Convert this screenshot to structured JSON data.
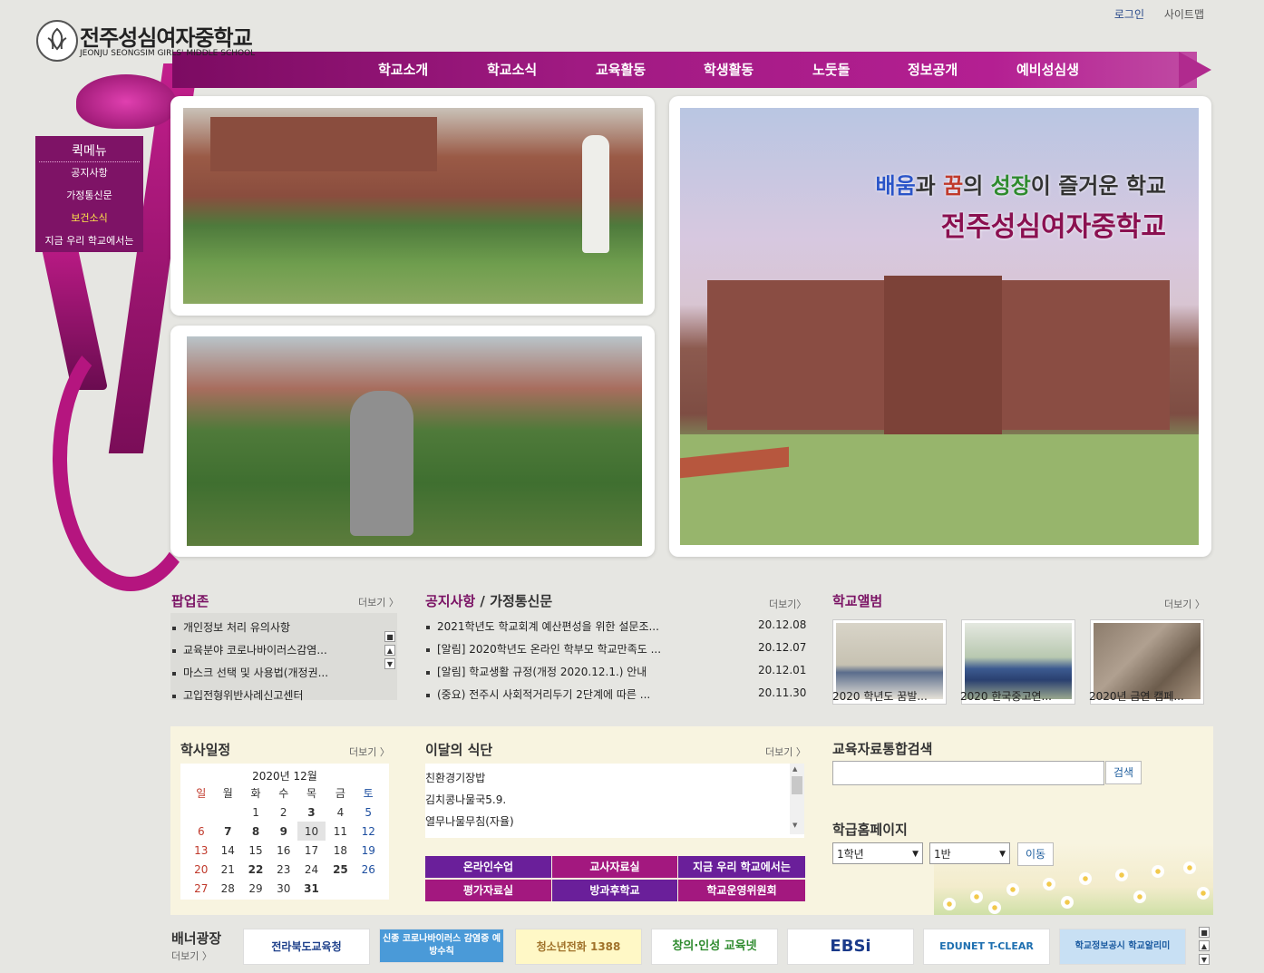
{
  "header": {
    "login": "로그인",
    "sitemap": "사이트맵",
    "logo_title": "전주성심여자중학교",
    "logo_sub": "JEONJU SEONGSIM GIRLS' MIDDLE SCHOOL",
    "nav": [
      "학교소개",
      "학교소식",
      "교육활동",
      "학생활동",
      "노둣돌",
      "정보공개",
      "예비성심생"
    ]
  },
  "quick_menu": {
    "title": "퀵메뉴",
    "items": [
      "공지사항",
      "가정통신문",
      "보건소식",
      "지금 우리 학교에서는"
    ]
  },
  "hero": {
    "slogan_line1_parts": [
      "배움",
      "과 ",
      "꿈",
      "의 ",
      "성장",
      "이 즐거운 학교"
    ],
    "slogan_line2": "전주성심여자중학교"
  },
  "popup_zone": {
    "title": "팝업존",
    "more": "더보기 〉",
    "items": [
      "개인정보 처리 유의사항",
      "교육분야 코로나바이러스감염...",
      "마스크 선택 및 사용법(개정권...",
      "고입전형위반사례신고센터"
    ]
  },
  "notice": {
    "title_a": "공지사항",
    "sep": " / ",
    "title_b": "가정통신문",
    "more": "더보기〉",
    "items": [
      {
        "text": "2021학년도 학교회계 예산편성을 위한 설문조...",
        "date": "20.12.08"
      },
      {
        "text": "[알림] 2020학년도 온라인 학부모 학교만족도 ...",
        "date": "20.12.07"
      },
      {
        "text": "[알림] 학교생활 규정(개정 2020.12.1.) 안내",
        "date": "20.12.01"
      },
      {
        "text": "(중요) 전주시 사회적거리두기 2단계에 따른 ...",
        "date": "20.11.30"
      }
    ]
  },
  "album": {
    "title": "학교앨범",
    "more": "더보기 〉",
    "items": [
      "2020 학년도 꿈발...",
      "2020 한국중고연...",
      "2020년 금연 캠페..."
    ]
  },
  "calendar": {
    "title": "학사일정",
    "more": "더보기 〉",
    "month": "2020년 12월",
    "weekdays": [
      "일",
      "월",
      "화",
      "수",
      "목",
      "금",
      "토"
    ],
    "weeks": [
      [
        "",
        "",
        "1",
        "2",
        "3",
        "4",
        "5"
      ],
      [
        "6",
        "7",
        "8",
        "9",
        "10",
        "11",
        "12"
      ],
      [
        "13",
        "14",
        "15",
        "16",
        "17",
        "18",
        "19"
      ],
      [
        "20",
        "21",
        "22",
        "23",
        "24",
        "25",
        "26"
      ],
      [
        "27",
        "28",
        "29",
        "30",
        "31",
        "",
        ""
      ]
    ]
  },
  "meal": {
    "title": "이달의 식단",
    "more": "더보기 〉",
    "items": [
      "친환경기장밥",
      "김치콩나물국5.9.",
      "열무나물무침(자율)"
    ]
  },
  "quick_buttons": [
    "온라인수업",
    "교사자료실",
    "지금 우리 학교에서는",
    "평가자료실",
    "방과후학교",
    "학교운영위원회"
  ],
  "search": {
    "title": "교육자료통합검색",
    "button": "검색",
    "value": ""
  },
  "class_home": {
    "title": "학급홈페이지",
    "grade": "1학년",
    "class": "1반",
    "go": "이동"
  },
  "banners": {
    "title": "배너광장",
    "more": "더보기 〉",
    "items": [
      "전라북도교육청",
      "신종 코로나바이러스 감염증 예방수칙",
      "청소년전화 1388",
      "창의·인성 교육넷",
      "EBSi",
      "EDUNET T-CLEAR",
      "학교정보공시 학교알리미"
    ]
  },
  "colors": {
    "brand_magenta": "#a01a82",
    "quick_purple": "#6a1f9a",
    "quick_magenta": "#a3187f",
    "section_title": "#7a1264"
  }
}
